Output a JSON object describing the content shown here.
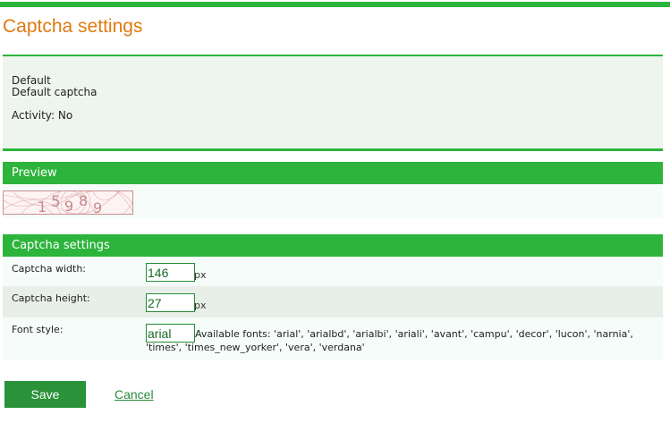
{
  "page": {
    "title": "Captcha settings"
  },
  "info": {
    "name": "Default",
    "description": "Default captcha",
    "activity_label": "Activity:",
    "activity_value": "No"
  },
  "preview": {
    "header": "Preview",
    "captcha_text": "15989"
  },
  "settings": {
    "header": "Captcha settings",
    "width": {
      "label": "Captcha width:",
      "value": "146",
      "unit": "px"
    },
    "height": {
      "label": "Captcha height:",
      "value": "27",
      "unit": "px"
    },
    "font": {
      "label": "Font style:",
      "value": "arial",
      "available": "Available fonts: 'arial', 'arialbd', 'arialbi', 'ariali', 'avant', 'campu', 'decor', 'lucon', 'narnia', 'times', 'times_new_yorker', 'vera', 'verdana'"
    }
  },
  "actions": {
    "save_label": "Save",
    "cancel_label": "Cancel"
  },
  "colors": {
    "accent": "#2db43c",
    "title": "#e07a10",
    "info_bg": "#eef5ee"
  }
}
